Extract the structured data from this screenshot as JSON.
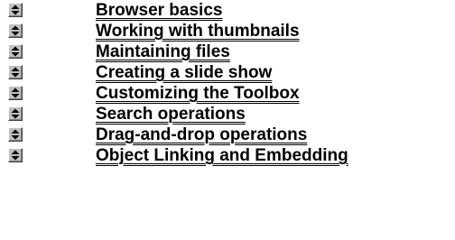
{
  "topics": [
    {
      "label": "Browser basics",
      "icon": "updown-arrow-icon"
    },
    {
      "label": "Working with thumbnails",
      "icon": "updown-arrow-icon"
    },
    {
      "label": "Maintaining files",
      "icon": "updown-arrow-icon"
    },
    {
      "label": "Creating a slide show",
      "icon": "updown-arrow-icon"
    },
    {
      "label": "Customizing the Toolbox",
      "icon": "updown-arrow-icon"
    },
    {
      "label": "Search operations",
      "icon": "updown-arrow-icon"
    },
    {
      "label": "Drag-and-drop operations",
      "icon": "updown-arrow-icon"
    },
    {
      "label": "Object Linking and Embedding",
      "icon": "updown-arrow-icon"
    }
  ],
  "colors": {
    "background": "#ffffff",
    "link_text": "#000000",
    "button_face": "#c0c0c0"
  }
}
